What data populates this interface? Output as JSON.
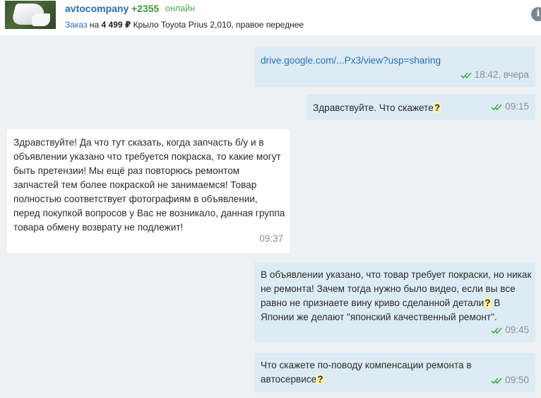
{
  "header": {
    "seller_name": "avtocompany",
    "seller_rating": "+2355",
    "seller_status": "онлайн",
    "order_link": "Заказ",
    "order_prefix": "на",
    "order_price": "4 499 ₽",
    "order_title": "Крыло Toyota Prius 2,010, правое переднее",
    "info_icon": "info-icon"
  },
  "messages": [
    {
      "direction": "out",
      "text": "drive.google.com/...Px3/view?usp=sharing",
      "time": "18:42, вчера",
      "read": true
    },
    {
      "direction": "out",
      "text": "Здравствуйте. Что скажете",
      "suffix": "?",
      "time": "09:15",
      "read": true
    },
    {
      "direction": "in",
      "text": "Здравствуйте! Да что тут сказать, когда запчасть б/у и в объявлении указано что требуется покраска, то какие могут быть претензии! Мы ещё раз повторюсь ремонтом запчастей тем более покраской не занимаемся! Товар полностью соответствует фотографиям в объявлении, перед покупкой вопросов у Вас не возникало, данная группа товара обмену возврату не подлежит!",
      "time": "09:37"
    },
    {
      "direction": "out",
      "text_a": "В объявлении указано, что товар требует покраски, но никак не ремонта! Зачем тогда нужно было видео, если вы все равно не признаете вину криво сделанной детали",
      "suffix": "?",
      "text_b": " В Японии же делают \"японский качественный ремонт\".",
      "time": "09:45",
      "read": true
    },
    {
      "direction": "out",
      "text": "Что скажете по-поводу компенсации ремонта в автосервисе",
      "suffix": "?",
      "time": "09:50",
      "read": true
    }
  ],
  "colors": {
    "outgoing_bubble": "#dcebf4",
    "incoming_bubble": "#ffffff",
    "background": "#edf1f4",
    "link": "#2b6fb4",
    "read_check": "#3fae49",
    "question_highlight": "#fff2a6"
  }
}
